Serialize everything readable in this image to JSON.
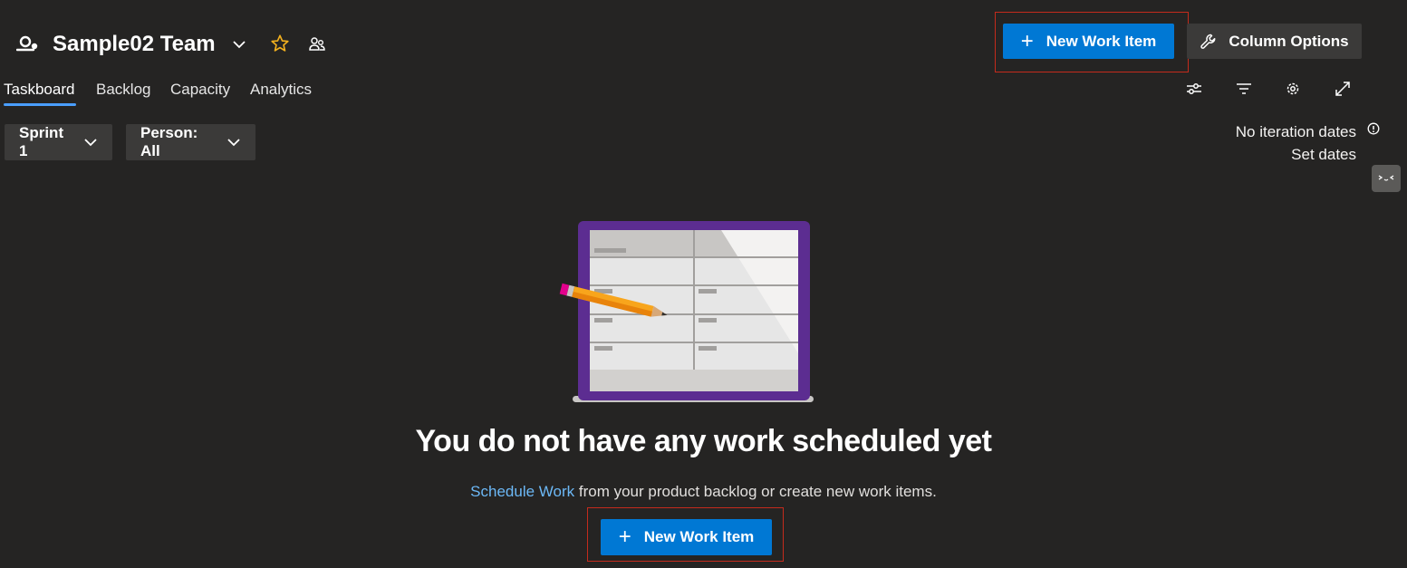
{
  "header": {
    "team_name": "Sample02 Team",
    "team_icon": "team-icon",
    "star_icon": "star-icon",
    "members_icon": "people-icon"
  },
  "toolbar": {
    "new_work_item_label": "New Work Item",
    "column_options_label": "Column Options"
  },
  "tabs": [
    {
      "label": "Taskboard",
      "active": true
    },
    {
      "label": "Backlog",
      "active": false
    },
    {
      "label": "Capacity",
      "active": false
    },
    {
      "label": "Analytics",
      "active": false
    }
  ],
  "view_tools": [
    "view-options-icon",
    "filter-icon",
    "settings-icon",
    "fullscreen-icon"
  ],
  "filters": {
    "sprint_label": "Sprint 1",
    "person_label": "Person: All"
  },
  "iteration": {
    "status": "No iteration dates",
    "set_dates_label": "Set dates"
  },
  "empty_state": {
    "title": "You do not have any work scheduled yet",
    "link_text": "Schedule Work",
    "description_rest": " from your product backlog or create new work items.",
    "button_label": "New Work Item"
  },
  "colors": {
    "background": "#252423",
    "primary": "#0078d4",
    "secondary_button": "#3b3a39",
    "highlight_border": "#c42b1c",
    "link": "#6cb8f6",
    "star": "#f2b01e",
    "board_frame": "#5c2d91",
    "pencil": "#f8a51c"
  }
}
